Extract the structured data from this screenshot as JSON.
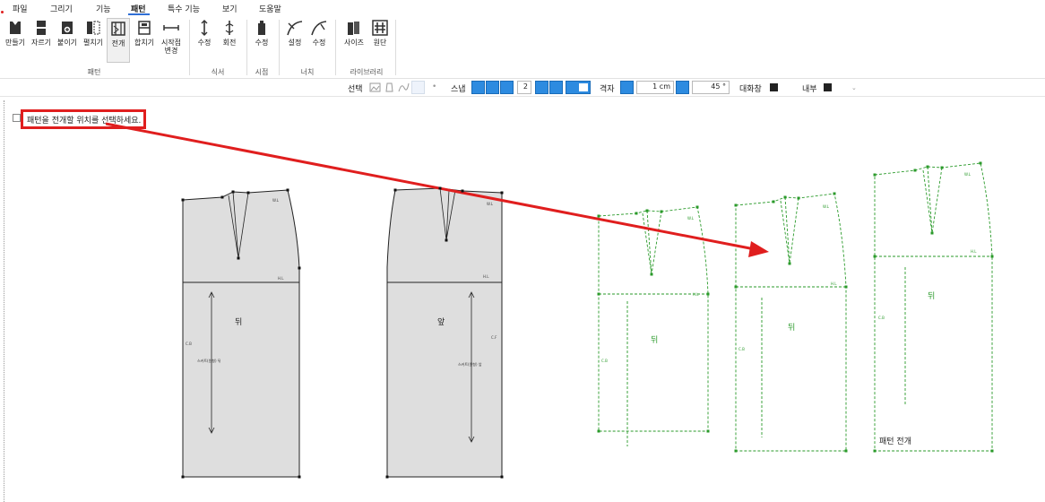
{
  "menu": {
    "items": [
      "파일",
      "그리기",
      "기능",
      "패턴",
      "특수 기능",
      "보기",
      "도움말"
    ],
    "active": "패턴"
  },
  "ribbon": {
    "tools": {
      "make": "만들기",
      "cut": "자르기",
      "attach": "붙이기",
      "spread": "펼치기",
      "unfold": "전개",
      "align": "합치기",
      "start_point": "시작점",
      "start_point_2": "변경",
      "seam_edit": "수정",
      "seam_rotate": "회전",
      "view_edit": "수정",
      "notch_set": "설정",
      "notch_edit": "수정",
      "size": "사이즈",
      "fabric": "원단"
    },
    "groups": {
      "pattern": "패턴",
      "seam": "식서",
      "view": "시점",
      "notch": "너치",
      "library": "라이브러리"
    }
  },
  "toolbar2": {
    "select_label": "선택",
    "snap_label": "스냅",
    "snap_value": "2",
    "grid_label": "격자",
    "grid_value": "1 cm",
    "angle_value": "45 °",
    "dialog_label": "대화창",
    "inner_label": "내부"
  },
  "prompt": {
    "text": "패턴을 전개할 위치를 선택하세요."
  },
  "patterns": {
    "back_label": "뒤",
    "front_label": "앞",
    "grain_back": "스커트(원형) 뒤",
    "grain_front": "스커트(원형) 앞",
    "wl": "W.L",
    "hl": "H.L",
    "cb": "C.B",
    "cf": "C.F",
    "caption": "패턴 전개"
  },
  "colors": {
    "accent_blue": "#2d8be0",
    "alert_red": "#e01e1e",
    "pattern_green": "#2a9a2a",
    "pattern_fill": "#dedede"
  }
}
